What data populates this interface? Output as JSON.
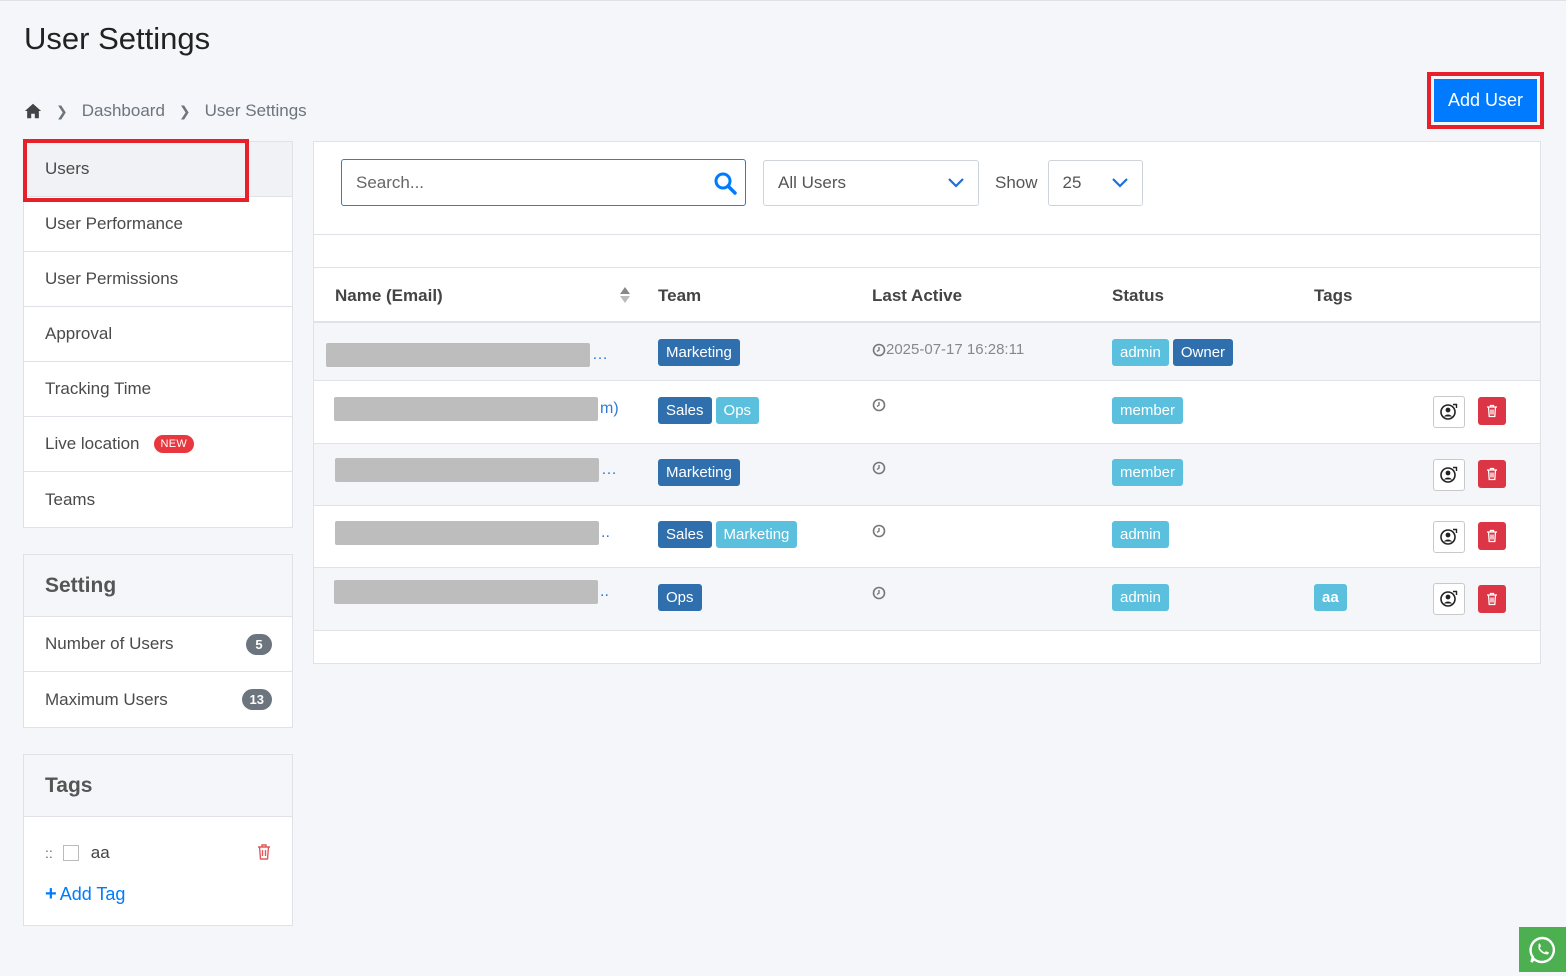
{
  "page": {
    "title": "User Settings"
  },
  "breadcrumb": {
    "items": [
      "Dashboard",
      "User Settings"
    ]
  },
  "actions": {
    "add_user_label": "Add User"
  },
  "sidebar": {
    "items": [
      {
        "label": "Users"
      },
      {
        "label": "User Performance"
      },
      {
        "label": "User Permissions"
      },
      {
        "label": "Approval"
      },
      {
        "label": "Tracking Time"
      },
      {
        "label": "Live location",
        "badge": "NEW"
      },
      {
        "label": "Teams"
      }
    ]
  },
  "setting": {
    "title": "Setting",
    "items": [
      {
        "label": "Number of Users",
        "count": "5"
      },
      {
        "label": "Maximum Users",
        "count": "13"
      }
    ]
  },
  "tags": {
    "title": "Tags",
    "items": [
      {
        "label": "aa"
      }
    ],
    "add_label": "Add Tag",
    "drag_handle": "::"
  },
  "filters": {
    "search_placeholder": "Search...",
    "user_filter": "All Users",
    "show_label": "Show",
    "page_size": "25"
  },
  "table": {
    "headers": {
      "name": "Name (Email)",
      "team": "Team",
      "last_active": "Last Active",
      "status": "Status",
      "tags": "Tags"
    },
    "rows": [
      {
        "name_tail": "…",
        "teams": [
          "Marketing"
        ],
        "last_active": "2025-07-17 16:28:11",
        "status": [
          "admin",
          "Owner"
        ],
        "tags": []
      },
      {
        "name_tail": "m)",
        "teams": [
          "Sales",
          "Ops"
        ],
        "last_active": "",
        "status": [
          "member"
        ],
        "tags": []
      },
      {
        "name_tail": "…",
        "teams": [
          "Marketing"
        ],
        "last_active": "",
        "status": [
          "member"
        ],
        "tags": []
      },
      {
        "name_tail": "..",
        "teams": [
          "Sales",
          "Marketing"
        ],
        "last_active": "",
        "status": [
          "admin"
        ],
        "tags": []
      },
      {
        "name_tail": "..",
        "teams": [
          "Ops"
        ],
        "last_active": "",
        "status": [
          "admin"
        ],
        "tags": [
          "aa"
        ]
      }
    ]
  },
  "colors": {
    "primary": "#007bff",
    "highlight": "#e8202a",
    "badge_dark": "#2f6fae",
    "badge_light": "#5bc0de",
    "danger": "#dc3545",
    "whatsapp": "#4caf50"
  }
}
